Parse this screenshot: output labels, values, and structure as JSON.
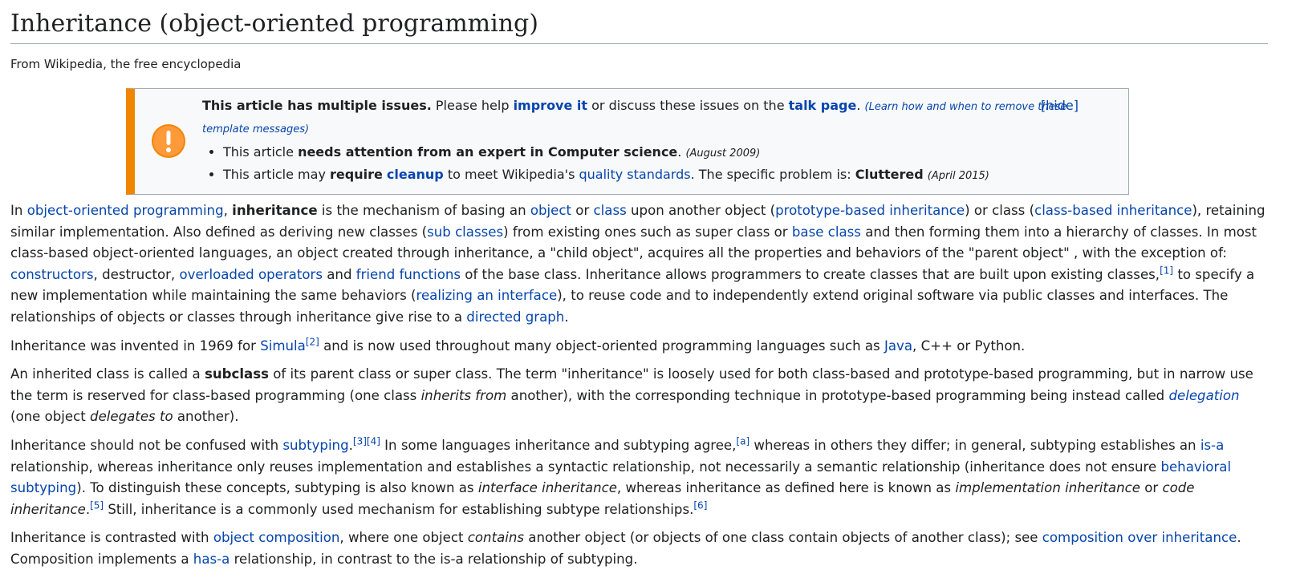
{
  "title": "Inheritance (object-oriented programming)",
  "tagline": "From Wikipedia, the free encyclopedia",
  "ambox": {
    "heading": "This article has multiple issues.",
    "t1": " Please help ",
    "improve": "improve it",
    "t2": " or discuss these issues on the ",
    "talk": "talk page",
    "t3": ". ",
    "learn": "(Learn how and when to remove these template messages)",
    "hide": "[hide]",
    "issue1_a": "This article ",
    "issue1_b": "needs attention from an expert in Computer science",
    "issue1_c": ".",
    "issue1_date": "(August 2009)",
    "issue2_a": "This article may ",
    "issue2_b": "require",
    "issue2_link": "cleanup",
    "issue2_c": " to meet Wikipedia's ",
    "issue2_link2": "quality standards",
    "issue2_d": ". The specific problem is: ",
    "issue2_e": "Cluttered",
    "issue2_date": "(April 2015)"
  },
  "p1": {
    "a": "In ",
    "l1": "object-oriented programming",
    "b": ", ",
    "bold": "inheritance",
    "c": " is the mechanism of basing an ",
    "l2": "object",
    "d": " or ",
    "l3": "class",
    "e": " upon another object (",
    "l4": "prototype-based inheritance",
    "f": ") or class (",
    "l5": "class-based inheritance",
    "g": "), retaining similar implementation. Also defined as deriving new classes (",
    "l6": "sub classes",
    "h": ") from existing ones such as super class or ",
    "l7": "base class",
    "i": " and then forming them into a hierarchy of classes. In most class-based object-oriented languages, an object created through inheritance, a \"child object\", acquires all the properties and behaviors of the \"parent object\" , with the exception of: ",
    "l8": "constructors",
    "j": ", destructor, ",
    "l9": "overloaded operators",
    "k": " and ",
    "l10": "friend functions",
    "m": " of the base class. Inheritance allows programmers to create classes that are built upon existing classes,",
    "ref1": "[1]",
    "n": " to specify a new implementation while maintaining the same behaviors (",
    "l11": "realizing an interface",
    "o": "), to reuse code and to independently extend original software via public classes and interfaces. The relationships of objects or classes through inheritance give rise to a ",
    "l12": "directed graph",
    "p": "."
  },
  "p2": {
    "a": "Inheritance was invented in 1969 for ",
    "l1": "Simula",
    "ref": "[2]",
    "b": " and is now used throughout many object-oriented programming languages such as ",
    "l2": "Java",
    "c": ", C++ or Python."
  },
  "p3": {
    "a": "An inherited class is called a ",
    "bold": "subclass",
    "b": " of its parent class or super class. The term \"inheritance\" is loosely used for both class-based and prototype-based programming, but in narrow use the term is reserved for class-based programming (one class ",
    "i1": "inherits from",
    "c": " another), with the corresponding technique in prototype-based programming being instead called ",
    "l1": "delegation",
    "d": " (one object ",
    "i2": "delegates to",
    "e": " another)."
  },
  "p4": {
    "a": "Inheritance should not be confused with ",
    "l1": "subtyping",
    "b": ".",
    "ref1": "[3][4]",
    "c": " In some languages inheritance and subtyping agree,",
    "ref2": "[a]",
    "d": " whereas in others they differ; in general, subtyping establishes an ",
    "l2": "is-a",
    "e": " relationship, whereas inheritance only reuses implementation and establishes a syntactic relationship, not necessarily a semantic relationship (inheritance does not ensure ",
    "l3": "behavioral subtyping",
    "f": "). To distinguish these concepts, subtyping is also known as ",
    "i1": "interface inheritance",
    "g": ", whereas inheritance as defined here is known as ",
    "i2": "implementation inheritance",
    "h": " or ",
    "i3": "code inheritance",
    "j": ".",
    "ref3": "[5]",
    "k": " Still, inheritance is a commonly used mechanism for establishing subtype relationships.",
    "ref4": "[6]"
  },
  "p5": {
    "a": "Inheritance is contrasted with ",
    "l1": "object composition",
    "b": ", where one object ",
    "i1": "contains",
    "c": " another object (or objects of one class contain objects of another class); see ",
    "l2": "composition over inheritance",
    "d": ". Composition implements a ",
    "l3": "has-a",
    "e": " relationship, in contrast to the is-a relationship of subtyping."
  },
  "colors": {
    "link": "#0645ad",
    "ambox_border": "#f28500",
    "text": "#202122"
  }
}
